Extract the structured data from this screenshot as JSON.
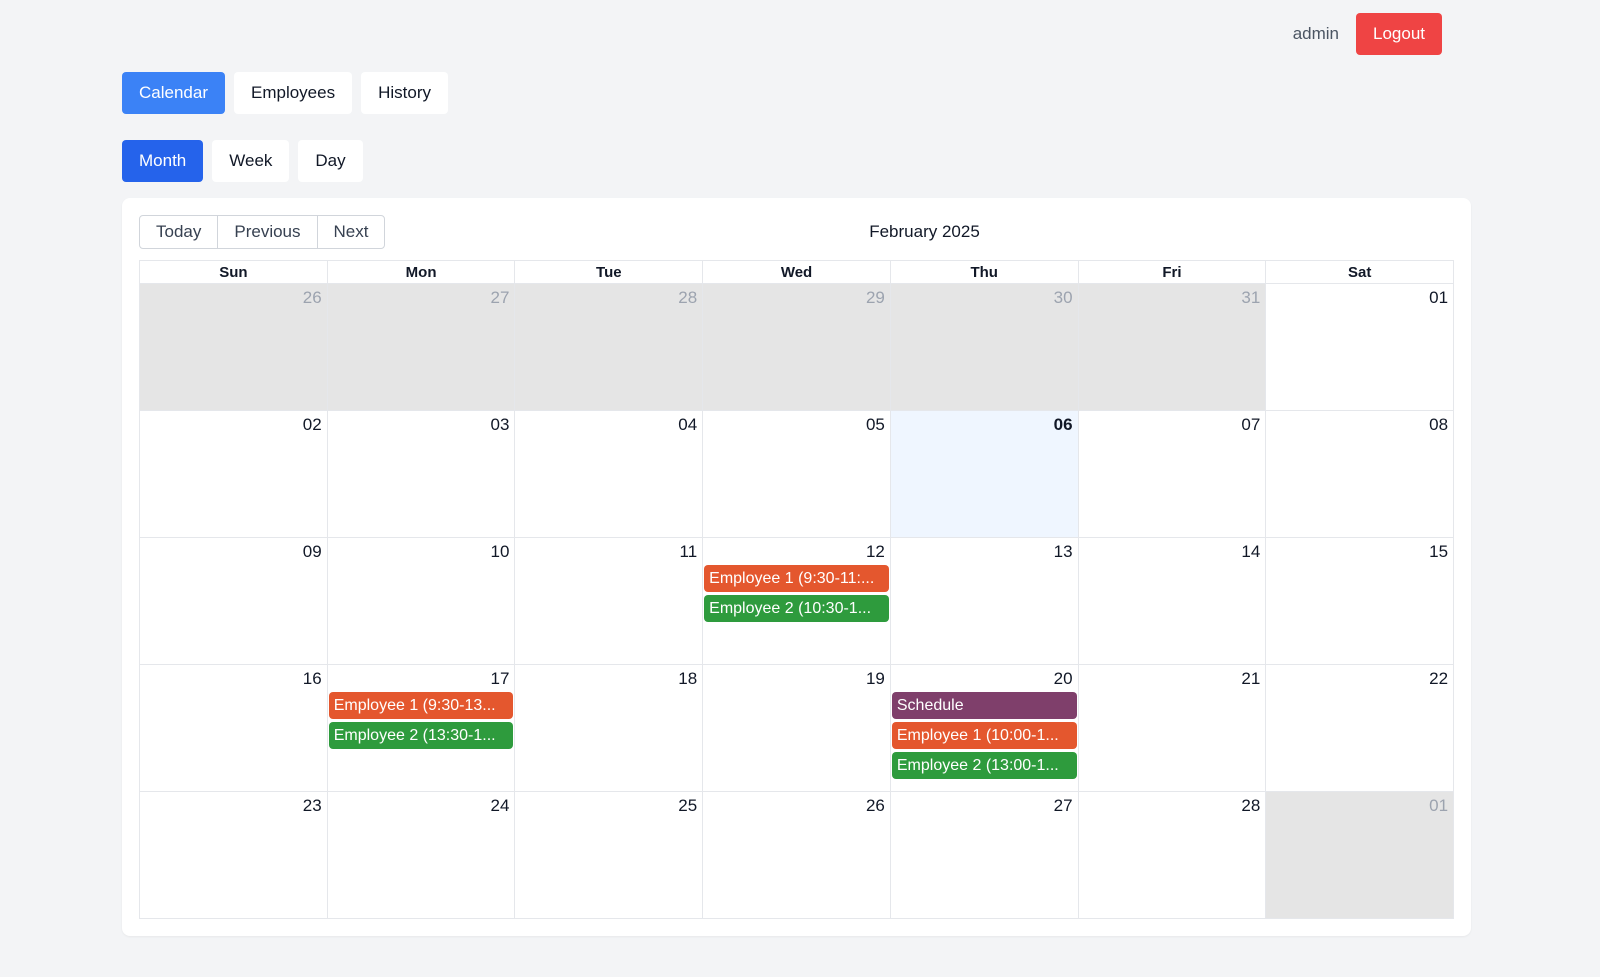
{
  "header": {
    "user": "admin",
    "logout_label": "Logout"
  },
  "nav": {
    "calendar": "Calendar",
    "employees": "Employees",
    "history": "History"
  },
  "views": {
    "month": "Month",
    "week": "Week",
    "day": "Day"
  },
  "toolbar": {
    "today": "Today",
    "previous": "Previous",
    "next": "Next"
  },
  "calendar": {
    "title": "February 2025",
    "weekdays": [
      "Sun",
      "Mon",
      "Tue",
      "Wed",
      "Thu",
      "Fri",
      "Sat"
    ],
    "colors": {
      "employee1": "#e4572e",
      "employee2": "#2e9b3d",
      "schedule": "#7f3f6b"
    },
    "weeks": [
      [
        {
          "num": "26",
          "other": true
        },
        {
          "num": "27",
          "other": true
        },
        {
          "num": "28",
          "other": true
        },
        {
          "num": "29",
          "other": true
        },
        {
          "num": "30",
          "other": true
        },
        {
          "num": "31",
          "other": true
        },
        {
          "num": "01"
        }
      ],
      [
        {
          "num": "02"
        },
        {
          "num": "03"
        },
        {
          "num": "04"
        },
        {
          "num": "05"
        },
        {
          "num": "06",
          "today": true
        },
        {
          "num": "07"
        },
        {
          "num": "08"
        }
      ],
      [
        {
          "num": "09"
        },
        {
          "num": "10"
        },
        {
          "num": "11"
        },
        {
          "num": "12",
          "events": [
            {
              "label": "Employee 1 (9:30-11:...",
              "color": "#e4572e"
            },
            {
              "label": "Employee 2 (10:30-1...",
              "color": "#2e9b3d"
            }
          ]
        },
        {
          "num": "13"
        },
        {
          "num": "14"
        },
        {
          "num": "15"
        }
      ],
      [
        {
          "num": "16"
        },
        {
          "num": "17",
          "events": [
            {
              "label": "Employee 1 (9:30-13...",
              "color": "#e4572e"
            },
            {
              "label": "Employee 2 (13:30-1...",
              "color": "#2e9b3d"
            }
          ]
        },
        {
          "num": "18"
        },
        {
          "num": "19"
        },
        {
          "num": "20",
          "events": [
            {
              "label": "Schedule",
              "color": "#7f3f6b"
            },
            {
              "label": "Employee 1 (10:00-1...",
              "color": "#e4572e"
            },
            {
              "label": "Employee 2 (13:00-1...",
              "color": "#2e9b3d"
            }
          ]
        },
        {
          "num": "21"
        },
        {
          "num": "22"
        }
      ],
      [
        {
          "num": "23"
        },
        {
          "num": "24"
        },
        {
          "num": "25"
        },
        {
          "num": "26"
        },
        {
          "num": "27"
        },
        {
          "num": "28"
        },
        {
          "num": "01",
          "other": true
        }
      ]
    ]
  }
}
